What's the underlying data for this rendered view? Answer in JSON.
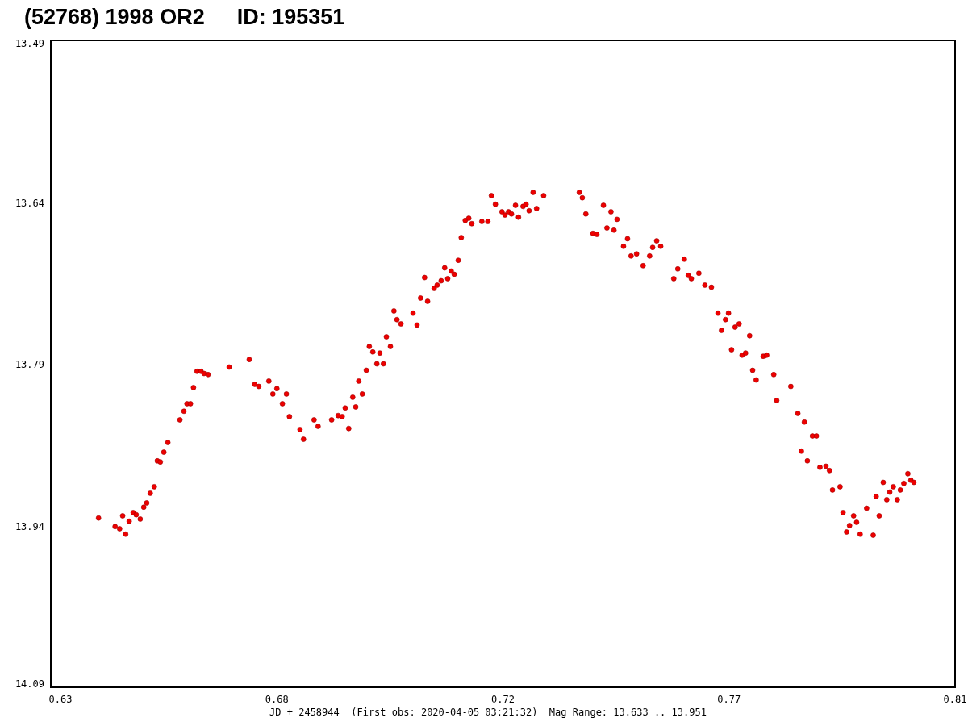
{
  "title": {
    "object": "(52768) 1998 OR2",
    "id": "ID: 195351"
  },
  "chart": {
    "chart_data": {
      "type": "scatter",
      "xlabel": "JD + 2458944  (First obs: 2020-04-05 03:21:32)  Mag Range: 13.633 .. 13.951",
      "xlim": [
        0.63,
        0.81
      ],
      "ylim": [
        14.09,
        13.49
      ],
      "xticks": [
        0.63,
        {
          "value": 0.675,
          "label": "0.68"
        },
        0.72,
        {
          "value": 0.765,
          "label": "0.77"
        },
        0.81
      ],
      "yticks": [
        13.49,
        13.64,
        13.79,
        13.94,
        14.09
      ],
      "x": [
        0.6395,
        0.6428,
        0.6437,
        0.6443,
        0.6449,
        0.6456,
        0.6464,
        0.647,
        0.6478,
        0.6485,
        0.6491,
        0.6498,
        0.6506,
        0.6512,
        0.6518,
        0.6525,
        0.6533,
        0.6557,
        0.6565,
        0.6571,
        0.6578,
        0.6584,
        0.6591,
        0.6599,
        0.6605,
        0.6613,
        0.6655,
        0.6695,
        0.6706,
        0.6714,
        0.6734,
        0.6742,
        0.675,
        0.6761,
        0.6769,
        0.6775,
        0.6796,
        0.6803,
        0.6824,
        0.6832,
        0.6859,
        0.6872,
        0.688,
        0.6886,
        0.6893,
        0.6901,
        0.6907,
        0.6913,
        0.692,
        0.6928,
        0.6934,
        0.6941,
        0.6949,
        0.6955,
        0.6962,
        0.6968,
        0.6976,
        0.6983,
        0.6989,
        0.6997,
        0.7021,
        0.7029,
        0.7036,
        0.7044,
        0.705,
        0.7063,
        0.7069,
        0.7077,
        0.7084,
        0.709,
        0.7097,
        0.7103,
        0.7111,
        0.7117,
        0.7125,
        0.7132,
        0.7138,
        0.7158,
        0.717,
        0.7177,
        0.7185,
        0.7198,
        0.7204,
        0.7211,
        0.7217,
        0.7225,
        0.7231,
        0.724,
        0.7246,
        0.7252,
        0.726,
        0.7267,
        0.7281,
        0.7352,
        0.7358,
        0.7365,
        0.7379,
        0.7387,
        0.74,
        0.7407,
        0.7415,
        0.7421,
        0.7427,
        0.744,
        0.7448,
        0.7455,
        0.7466,
        0.7479,
        0.7492,
        0.7498,
        0.7506,
        0.7514,
        0.754,
        0.7548,
        0.7561,
        0.7569,
        0.7575,
        0.759,
        0.7602,
        0.7615,
        0.7628,
        0.7635,
        0.7643,
        0.7649,
        0.7655,
        0.7662,
        0.767,
        0.7676,
        0.7683,
        0.7691,
        0.7697,
        0.7704,
        0.7718,
        0.7725,
        0.7739,
        0.7745,
        0.7773,
        0.7787,
        0.7794,
        0.78,
        0.7806,
        0.7816,
        0.7824,
        0.7831,
        0.7843,
        0.785,
        0.7856,
        0.7871,
        0.7877,
        0.7884,
        0.789,
        0.7898,
        0.7904,
        0.7911,
        0.7924,
        0.7937,
        0.7943,
        0.7949,
        0.7957,
        0.7964,
        0.797,
        0.7977,
        0.7985,
        0.7991,
        0.7998,
        0.8006,
        0.8012,
        0.8018
      ],
      "series": [
        {
          "color": "#ee0000",
          "values": [
            13.933,
            13.941,
            13.943,
            13.931,
            13.948,
            13.936,
            13.928,
            13.93,
            13.934,
            13.923,
            13.919,
            13.91,
            13.904,
            13.88,
            13.881,
            13.872,
            13.863,
            13.842,
            13.834,
            13.827,
            13.827,
            13.812,
            13.797,
            13.797,
            13.799,
            13.8,
            13.793,
            13.786,
            13.809,
            13.811,
            13.806,
            13.818,
            13.813,
            13.827,
            13.818,
            13.839,
            13.851,
            13.86,
            13.842,
            13.848,
            13.842,
            13.838,
            13.839,
            13.831,
            13.85,
            13.821,
            13.83,
            13.806,
            13.818,
            13.796,
            13.774,
            13.779,
            13.79,
            13.78,
            13.79,
            13.765,
            13.774,
            13.741,
            13.749,
            13.753,
            13.743,
            13.754,
            13.729,
            13.71,
            13.732,
            13.72,
            13.717,
            13.713,
            13.701,
            13.711,
            13.704,
            13.707,
            13.694,
            13.673,
            13.657,
            13.655,
            13.66,
            13.658,
            13.658,
            13.634,
            13.642,
            13.649,
            13.652,
            13.649,
            13.651,
            13.643,
            13.654,
            13.644,
            13.642,
            13.648,
            13.631,
            13.646,
            13.634,
            13.631,
            13.636,
            13.651,
            13.669,
            13.67,
            13.643,
            13.664,
            13.649,
            13.666,
            13.656,
            13.681,
            13.674,
            13.69,
            13.688,
            13.699,
            13.69,
            13.682,
            13.676,
            13.681,
            13.711,
            13.702,
            13.693,
            13.708,
            13.711,
            13.706,
            13.717,
            13.719,
            13.743,
            13.759,
            13.749,
            13.743,
            13.777,
            13.756,
            13.753,
            13.782,
            13.78,
            13.764,
            13.796,
            13.805,
            13.783,
            13.782,
            13.8,
            13.824,
            13.811,
            13.836,
            13.871,
            13.844,
            13.88,
            13.857,
            13.857,
            13.886,
            13.885,
            13.889,
            13.907,
            13.904,
            13.928,
            13.946,
            13.94,
            13.931,
            13.937,
            13.948,
            13.924,
            13.949,
            13.913,
            13.931,
            13.9,
            13.916,
            13.909,
            13.904,
            13.916,
            13.907,
            13.901,
            13.892,
            13.898,
            13.9
          ]
        }
      ]
    }
  }
}
